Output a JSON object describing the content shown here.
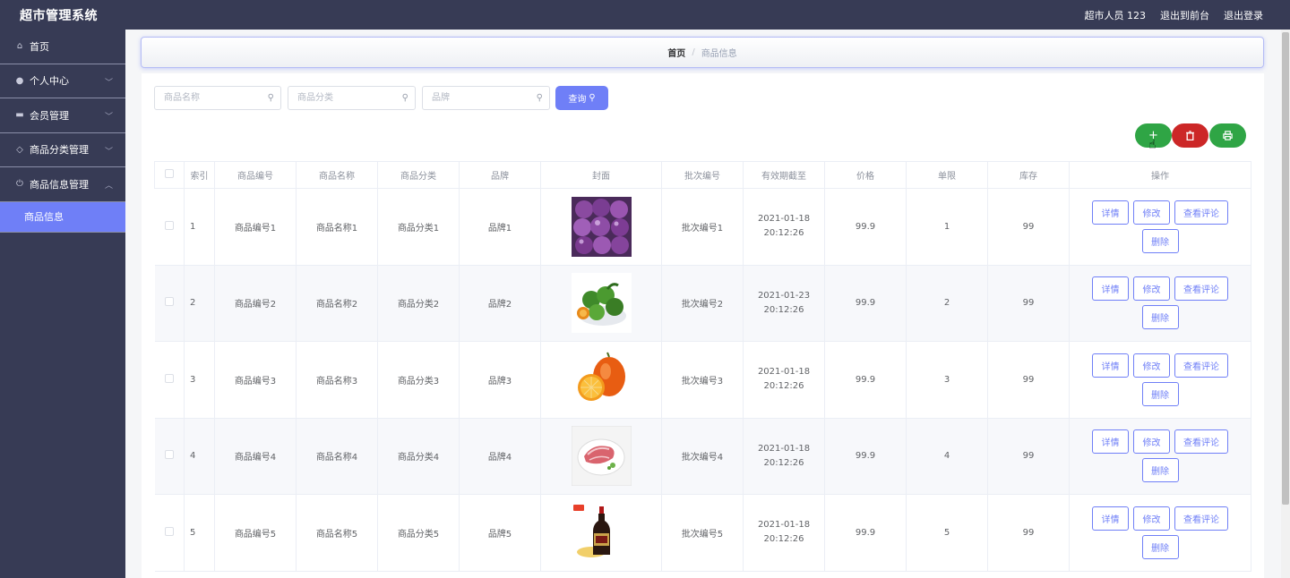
{
  "header": {
    "app_title": "超市管理系统",
    "user_label": "超市人员 123",
    "back_to_front": "退出到前台",
    "logout": "退出登录"
  },
  "sidebar": {
    "items": [
      {
        "label": "首页",
        "icon": "home-icon"
      },
      {
        "label": "个人中心",
        "icon": "user-icon"
      },
      {
        "label": "会员管理",
        "icon": "id-card-icon"
      },
      {
        "label": "商品分类管理",
        "icon": "tag-icon"
      },
      {
        "label": "商品信息管理",
        "icon": "power-icon"
      }
    ],
    "active_sub": "商品信息"
  },
  "breadcrumb": {
    "home": "首页",
    "separator": "/",
    "current": "商品信息"
  },
  "search": {
    "name_placeholder": "商品名称",
    "category_placeholder": "商品分类",
    "brand_placeholder": "品牌",
    "button_label": "查询"
  },
  "actions": {
    "add": "+",
    "delete_icon": "trash-icon",
    "print_icon": "printer-icon"
  },
  "table": {
    "columns": [
      "索引",
      "商品编号",
      "商品名称",
      "商品分类",
      "品牌",
      "封面",
      "批次编号",
      "有效期截至",
      "价格",
      "单限",
      "库存",
      "操作"
    ],
    "op_labels": {
      "detail": "详情",
      "edit": "修改",
      "comments": "查看评论",
      "delete": "删除"
    },
    "rows": [
      {
        "index": "1",
        "code": "商品编号1",
        "name": "商品名称1",
        "category": "商品分类1",
        "brand": "品牌1",
        "cover": "purple-fruit",
        "batch": "批次编号1",
        "expiry": "2021-01-18 20:12:26",
        "price": "99.9",
        "limit": "1",
        "stock": "99"
      },
      {
        "index": "2",
        "code": "商品编号2",
        "name": "商品名称2",
        "category": "商品分类2",
        "brand": "品牌2",
        "cover": "green-fruit-bowl",
        "batch": "批次编号2",
        "expiry": "2021-01-23 20:12:26",
        "price": "99.9",
        "limit": "2",
        "stock": "99"
      },
      {
        "index": "3",
        "code": "商品编号3",
        "name": "商品名称3",
        "category": "商品分类3",
        "brand": "品牌3",
        "cover": "oranges",
        "batch": "批次编号3",
        "expiry": "2021-01-18 20:12:26",
        "price": "99.9",
        "limit": "3",
        "stock": "99"
      },
      {
        "index": "4",
        "code": "商品编号4",
        "name": "商品名称4",
        "category": "商品分类4",
        "brand": "品牌4",
        "cover": "meat-plate",
        "batch": "批次编号4",
        "expiry": "2021-01-18 20:12:26",
        "price": "99.9",
        "limit": "4",
        "stock": "99"
      },
      {
        "index": "5",
        "code": "商品编号5",
        "name": "商品名称5",
        "category": "商品分类5",
        "brand": "品牌5",
        "cover": "sauce-bottle",
        "batch": "批次编号5",
        "expiry": "2021-01-18 20:12:26",
        "price": "99.9",
        "limit": "5",
        "stock": "99"
      }
    ]
  },
  "colors": {
    "topbar": "#373b55",
    "accent": "#6f7ff7",
    "green": "#2fa545",
    "red": "#cc2727"
  }
}
